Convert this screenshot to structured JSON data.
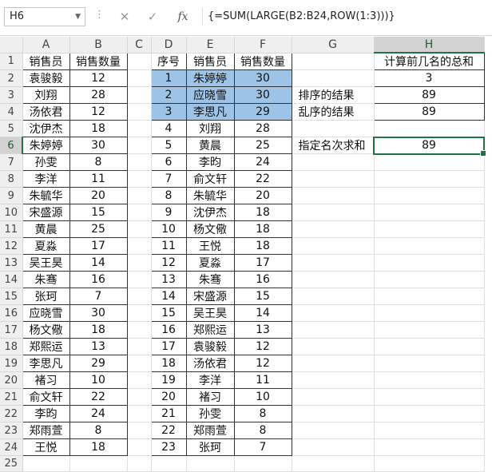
{
  "name_box": "H6",
  "formula_bar": {
    "cancel_icon": "✕",
    "enter_icon": "✓",
    "fx_label": "fx",
    "formula": "{=SUM(LARGE(B2:B24,ROW(1:3)))}"
  },
  "columns": [
    "A",
    "B",
    "C",
    "D",
    "E",
    "F",
    "G",
    "H"
  ],
  "rows": [
    {
      "num": "1",
      "a": "销售员",
      "b": "销售数量",
      "c": "",
      "d": "序号",
      "e": "销售员",
      "f": "销售数量",
      "g": "",
      "h": "计算前几名的总和"
    },
    {
      "num": "2",
      "a": "袁骏毅",
      "b": "12",
      "c": "",
      "d": "1",
      "e": "朱婷婷",
      "f": "30",
      "g": "",
      "h": "3"
    },
    {
      "num": "3",
      "a": "刘翔",
      "b": "28",
      "c": "",
      "d": "2",
      "e": "应晓雪",
      "f": "30",
      "g": "排序的结果",
      "h": "89"
    },
    {
      "num": "4",
      "a": "汤依君",
      "b": "12",
      "c": "",
      "d": "3",
      "e": "李思凡",
      "f": "29",
      "g": "乱序的结果",
      "h": "89"
    },
    {
      "num": "5",
      "a": "沈伊杰",
      "b": "18",
      "c": "",
      "d": "4",
      "e": "刘翔",
      "f": "28",
      "g": "",
      "h": ""
    },
    {
      "num": "6",
      "a": "朱婷婷",
      "b": "30",
      "c": "",
      "d": "5",
      "e": "黄晨",
      "f": "25",
      "g": "指定名次求和",
      "h": "89"
    },
    {
      "num": "7",
      "a": "孙雯",
      "b": "8",
      "c": "",
      "d": "6",
      "e": "李昀",
      "f": "24",
      "g": "",
      "h": ""
    },
    {
      "num": "8",
      "a": "李洋",
      "b": "11",
      "c": "",
      "d": "7",
      "e": "俞文轩",
      "f": "22",
      "g": "",
      "h": ""
    },
    {
      "num": "9",
      "a": "朱毓华",
      "b": "20",
      "c": "",
      "d": "8",
      "e": "朱毓华",
      "f": "20",
      "g": "",
      "h": ""
    },
    {
      "num": "10",
      "a": "宋盛源",
      "b": "15",
      "c": "",
      "d": "9",
      "e": "沈伊杰",
      "f": "18",
      "g": "",
      "h": ""
    },
    {
      "num": "11",
      "a": "黄晨",
      "b": "25",
      "c": "",
      "d": "10",
      "e": "杨文儆",
      "f": "18",
      "g": "",
      "h": ""
    },
    {
      "num": "12",
      "a": "夏淼",
      "b": "17",
      "c": "",
      "d": "11",
      "e": "王悦",
      "f": "18",
      "g": "",
      "h": ""
    },
    {
      "num": "13",
      "a": "吴王昊",
      "b": "14",
      "c": "",
      "d": "12",
      "e": "夏淼",
      "f": "17",
      "g": "",
      "h": ""
    },
    {
      "num": "14",
      "a": "朱骞",
      "b": "16",
      "c": "",
      "d": "13",
      "e": "朱骞",
      "f": "16",
      "g": "",
      "h": ""
    },
    {
      "num": "15",
      "a": "张珂",
      "b": "7",
      "c": "",
      "d": "14",
      "e": "宋盛源",
      "f": "15",
      "g": "",
      "h": ""
    },
    {
      "num": "16",
      "a": "应晓雪",
      "b": "30",
      "c": "",
      "d": "15",
      "e": "吴王昊",
      "f": "14",
      "g": "",
      "h": ""
    },
    {
      "num": "17",
      "a": "杨文儆",
      "b": "18",
      "c": "",
      "d": "16",
      "e": "郑熙运",
      "f": "13",
      "g": "",
      "h": ""
    },
    {
      "num": "18",
      "a": "郑熙运",
      "b": "13",
      "c": "",
      "d": "17",
      "e": "袁骏毅",
      "f": "12",
      "g": "",
      "h": ""
    },
    {
      "num": "19",
      "a": "李思凡",
      "b": "29",
      "c": "",
      "d": "18",
      "e": "汤依君",
      "f": "12",
      "g": "",
      "h": ""
    },
    {
      "num": "20",
      "a": "褚习",
      "b": "10",
      "c": "",
      "d": "19",
      "e": "李洋",
      "f": "11",
      "g": "",
      "h": ""
    },
    {
      "num": "21",
      "a": "俞文轩",
      "b": "22",
      "c": "",
      "d": "20",
      "e": "褚习",
      "f": "10",
      "g": "",
      "h": ""
    },
    {
      "num": "22",
      "a": "李昀",
      "b": "24",
      "c": "",
      "d": "21",
      "e": "孙雯",
      "f": "8",
      "g": "",
      "h": ""
    },
    {
      "num": "23",
      "a": "郑雨萱",
      "b": "8",
      "c": "",
      "d": "22",
      "e": "郑雨萱",
      "f": "8",
      "g": "",
      "h": ""
    },
    {
      "num": "24",
      "a": "王悦",
      "b": "18",
      "c": "",
      "d": "23",
      "e": "张珂",
      "f": "7",
      "g": "",
      "h": ""
    },
    {
      "num": "25",
      "a": "",
      "b": "",
      "c": "",
      "d": "",
      "e": "",
      "f": "",
      "g": "",
      "h": ""
    }
  ],
  "colors": {
    "highlight": "#9dc3e6",
    "selection": "#217346"
  },
  "icons": {
    "name_box_dropdown": "chevron-down-icon",
    "cancel": "close-icon",
    "enter": "check-icon",
    "function": "fx-icon"
  }
}
